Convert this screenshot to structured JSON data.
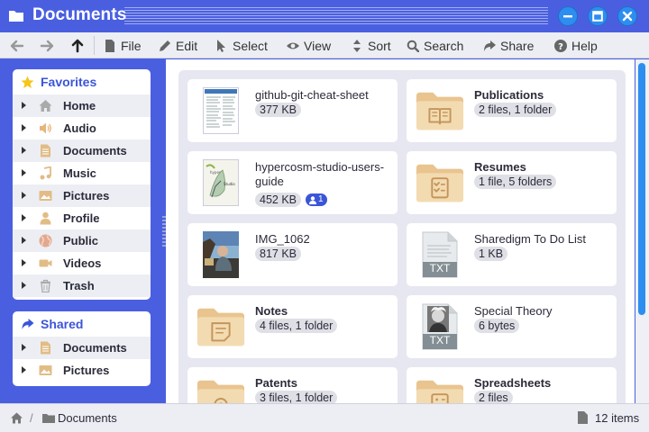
{
  "window": {
    "title": "Documents"
  },
  "toolbar": {
    "items": [
      {
        "label": "File",
        "icon": "file-icon"
      },
      {
        "label": "Edit",
        "icon": "pencil-icon"
      },
      {
        "label": "Select",
        "icon": "cursor-icon"
      },
      {
        "label": "View",
        "icon": "eye-icon"
      },
      {
        "label": "Sort",
        "icon": "sort-icon"
      },
      {
        "label": "Search",
        "icon": "search-icon"
      },
      {
        "label": "Share",
        "icon": "share-icon"
      },
      {
        "label": "Help",
        "icon": "help-icon"
      }
    ]
  },
  "sidebar": {
    "favorites": {
      "title": "Favorites",
      "items": [
        {
          "label": "Home",
          "icon": "home-icon"
        },
        {
          "label": "Audio",
          "icon": "speaker-icon"
        },
        {
          "label": "Documents",
          "icon": "document-icon"
        },
        {
          "label": "Music",
          "icon": "music-note-icon"
        },
        {
          "label": "Pictures",
          "icon": "picture-icon"
        },
        {
          "label": "Profile",
          "icon": "user-icon"
        },
        {
          "label": "Public",
          "icon": "globe-icon"
        },
        {
          "label": "Videos",
          "icon": "video-icon"
        },
        {
          "label": "Trash",
          "icon": "trash-icon"
        }
      ]
    },
    "shared": {
      "title": "Shared",
      "items": [
        {
          "label": "Documents",
          "icon": "document-icon"
        },
        {
          "label": "Pictures",
          "icon": "picture-icon"
        }
      ]
    }
  },
  "files": [
    {
      "name": "github-git-cheat-sheet",
      "meta": "377 KB",
      "kind": "pdf-document"
    },
    {
      "name": "Publications",
      "meta": "2 files, 1 folder",
      "kind": "folder-book"
    },
    {
      "name": "hypercosm-studio-users-guide",
      "meta": "452 KB",
      "kind": "pdf-guide",
      "shared_count": "1"
    },
    {
      "name": "Resumes",
      "meta": "1 file, 5 folders",
      "kind": "folder-checklist"
    },
    {
      "name": "IMG_1062",
      "meta": "817 KB",
      "kind": "photo"
    },
    {
      "name": "Sharedigm To Do List",
      "meta": "1 KB",
      "kind": "txt",
      "tag": "TXT"
    },
    {
      "name": "Notes",
      "meta": "4 files, 1 folder",
      "kind": "folder-notes"
    },
    {
      "name": "Special Theory",
      "meta": "6 bytes",
      "kind": "txt-portrait",
      "tag": "TXT"
    },
    {
      "name": "Patents",
      "meta": "3 files, 1 folder",
      "kind": "folder-gear"
    },
    {
      "name": "Spreadsheets",
      "meta": "2 files",
      "kind": "folder-calculator"
    }
  ],
  "statusbar": {
    "path": "Documents",
    "count": "12 items"
  },
  "colors": {
    "accent": "#4a5fe0",
    "button": "#2d8ef0",
    "folder": "#f1d9ae"
  }
}
